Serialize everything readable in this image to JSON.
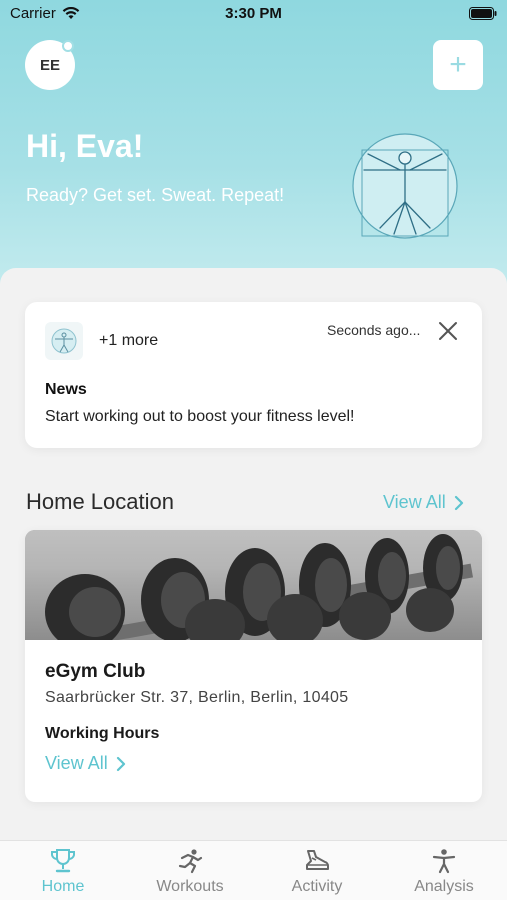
{
  "status_bar": {
    "carrier": "Carrier",
    "time": "3:30 PM"
  },
  "header": {
    "avatar_initials": "EE",
    "add_button": "+",
    "greeting": "Hi, Eva!",
    "tagline": "Ready? Get set. Sweat. Repeat!"
  },
  "news_card": {
    "more": "+1 more",
    "timestamp": "Seconds ago...",
    "title": "News",
    "body": "Start working out to boost your fitness level!"
  },
  "home_location": {
    "section_title": "Home Location",
    "view_all": "View All",
    "gym_name": "eGym Club",
    "address": "Saarbrücker Str. 37, Berlin, Berlin, 10405",
    "working_hours_label": "Working Hours",
    "hours_view_all": "View All"
  },
  "tabbar": {
    "items": [
      {
        "label": "Home",
        "icon": "trophy-icon",
        "active": true
      },
      {
        "label": "Workouts",
        "icon": "runner-icon",
        "active": false
      },
      {
        "label": "Activity",
        "icon": "shoe-icon",
        "active": false
      },
      {
        "label": "Analysis",
        "icon": "person-icon",
        "active": false
      }
    ]
  },
  "colors": {
    "accent": "#5ec4cf",
    "hero_top": "#8fd8df",
    "hero_bottom": "#c6ecef"
  }
}
